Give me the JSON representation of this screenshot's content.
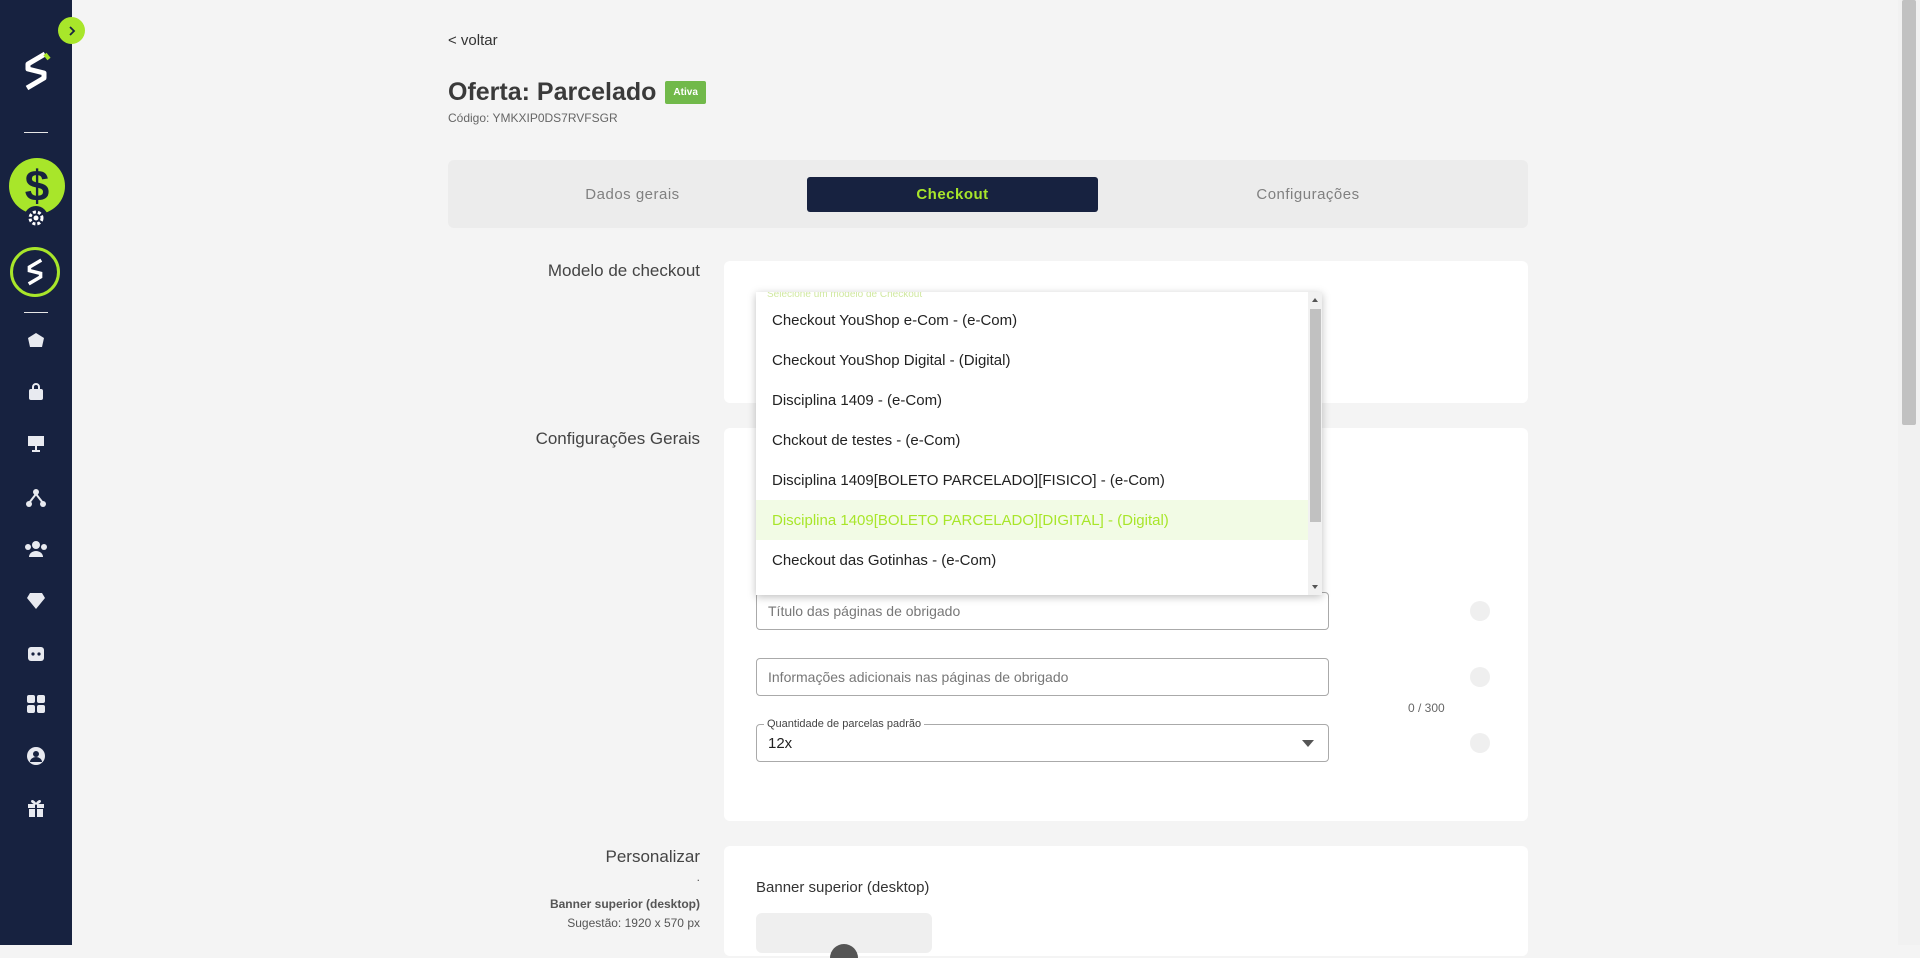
{
  "sidebar": {
    "icons": [
      "expand-toggle-icon",
      "logo-icon",
      "dollar-icon",
      "gear-icon",
      "brand-ring-icon",
      "home-icon",
      "bag-icon",
      "presentation-icon",
      "network-icon",
      "users-icon",
      "diamond-icon",
      "dice-icon",
      "apps-icon",
      "account-icon",
      "gift-icon"
    ]
  },
  "header": {
    "back_label": "< voltar",
    "title": "Oferta: Parcelado",
    "status_badge": "Ativa",
    "code": "Código: YMKXIP0DS7RVFSGR"
  },
  "tabs": [
    {
      "label": "Dados gerais",
      "active": false
    },
    {
      "label": "Checkout",
      "active": true
    },
    {
      "label": "Configurações",
      "active": false
    }
  ],
  "checkout_model": {
    "section_label": "Modelo de checkout",
    "select_label": "Selecione um modelo de Checkout",
    "options": [
      "Checkout YouShop e-Com - (e-Com)",
      "Checkout YouShop Digital - (Digital)",
      "Disciplina 1409 - (e-Com)",
      "Chckout de testes - (e-Com)",
      "Disciplina 1409[BOLETO PARCELADO][FISICO] - (e-Com)",
      "Disciplina 1409[BOLETO PARCELADO][DIGITAL] - (Digital)",
      "Checkout das Gotinhas - (e-Com)"
    ],
    "highlighted_index": 5
  },
  "general_settings": {
    "section_label": "Configurações Gerais",
    "thanks_title_placeholder": "Título das páginas de obrigado",
    "thanks_info_placeholder": "Informações adicionais nas páginas de obrigado",
    "thanks_info_counter": "0 / 300",
    "installments_label": "Quantidade de parcelas padrão",
    "installments_value": "12x"
  },
  "customize": {
    "section_label": "Personalizar",
    "dot": ".",
    "banner_label": "Banner superior (desktop)",
    "banner_hint": "Sugestão: 1920 x 570 px",
    "banner_card_title": "Banner superior (desktop)"
  },
  "colors": {
    "sidebar_bg": "#172240",
    "accent": "#a8e62a",
    "badge_green": "#71b94a"
  }
}
